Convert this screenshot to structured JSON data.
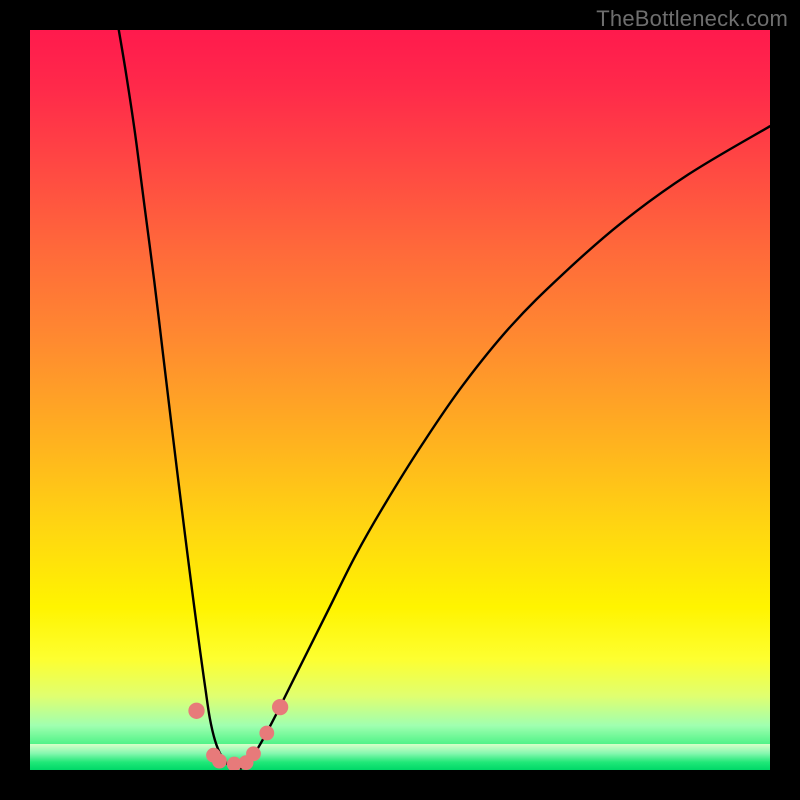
{
  "watermark": "TheBottleneck.com",
  "chart_data": {
    "type": "line",
    "title": "",
    "xlabel": "",
    "ylabel": "",
    "xlim": [
      0,
      100
    ],
    "ylim": [
      0,
      100
    ],
    "grid": false,
    "series": [
      {
        "name": "left-curve",
        "x": [
          12.0,
          13.0,
          14.2,
          15.5,
          16.8,
          18.0,
          19.2,
          20.3,
          21.3,
          22.2,
          23.0,
          23.7,
          24.3,
          25.0,
          25.8,
          26.7,
          27.7
        ],
        "y": [
          100.0,
          94.0,
          86.0,
          76.0,
          66.0,
          56.0,
          46.0,
          37.0,
          29.0,
          22.0,
          16.0,
          11.0,
          7.0,
          4.0,
          2.0,
          0.8,
          0.2
        ]
      },
      {
        "name": "right-curve",
        "x": [
          28.5,
          29.3,
          30.2,
          31.4,
          33.0,
          35.0,
          37.5,
          40.5,
          44.0,
          48.0,
          53.0,
          58.5,
          65.0,
          72.0,
          80.0,
          89.0,
          100.0
        ],
        "y": [
          0.2,
          0.8,
          2.0,
          4.0,
          7.0,
          11.0,
          16.0,
          22.0,
          29.0,
          36.0,
          44.0,
          52.0,
          60.0,
          67.0,
          74.0,
          80.5,
          87.0
        ]
      }
    ],
    "markers": [
      {
        "name": "marker-left-tip",
        "x": 22.5,
        "y": 8.0,
        "r": 1.1
      },
      {
        "name": "marker-bottom-1",
        "x": 24.8,
        "y": 2.0,
        "r": 1.0
      },
      {
        "name": "marker-bottom-2",
        "x": 25.6,
        "y": 1.2,
        "r": 1.0
      },
      {
        "name": "marker-bottom-3",
        "x": 27.6,
        "y": 0.8,
        "r": 1.0
      },
      {
        "name": "marker-bottom-4",
        "x": 29.2,
        "y": 1.0,
        "r": 1.0
      },
      {
        "name": "marker-right-tip-1",
        "x": 30.2,
        "y": 2.2,
        "r": 1.0
      },
      {
        "name": "marker-right-tip-2",
        "x": 32.0,
        "y": 5.0,
        "r": 1.0
      },
      {
        "name": "marker-right-tip-3",
        "x": 33.8,
        "y": 8.5,
        "r": 1.1
      }
    ],
    "colors": {
      "curve": "#000000",
      "marker": "#e77a7a",
      "gradient_top": "#ff1a4d",
      "gradient_mid": "#ffd810",
      "gradient_bottom": "#00e070"
    }
  }
}
